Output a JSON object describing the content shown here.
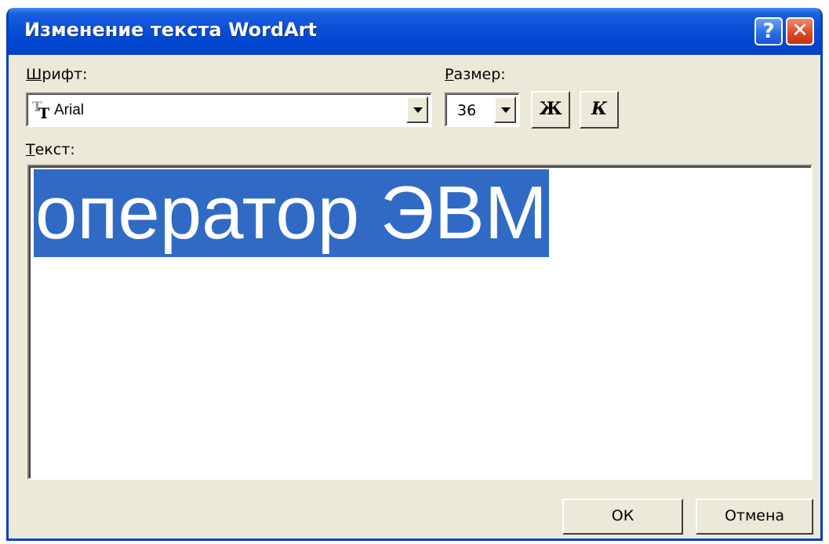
{
  "window": {
    "title": "Изменение текста WordArt",
    "help_glyph": "?",
    "close_glyph": "✕"
  },
  "font": {
    "label_accel": "Ш",
    "label_rest": "рифт:",
    "value": "Arial",
    "icon": "truetype-font-icon"
  },
  "size": {
    "label_accel": "Р",
    "label_rest": "азмер:",
    "value": "36"
  },
  "format": {
    "bold_label": "Ж",
    "italic_label": "К"
  },
  "text": {
    "label_accel": "Т",
    "label_rest": "екст:",
    "value": "оператор ЭВМ"
  },
  "buttons": {
    "ok_label": "ОК",
    "cancel_label": "Отмена"
  },
  "colors": {
    "titlebar": "#0047d0",
    "selection": "#316ac5",
    "face": "#ece9d8",
    "close": "#d9452a"
  }
}
